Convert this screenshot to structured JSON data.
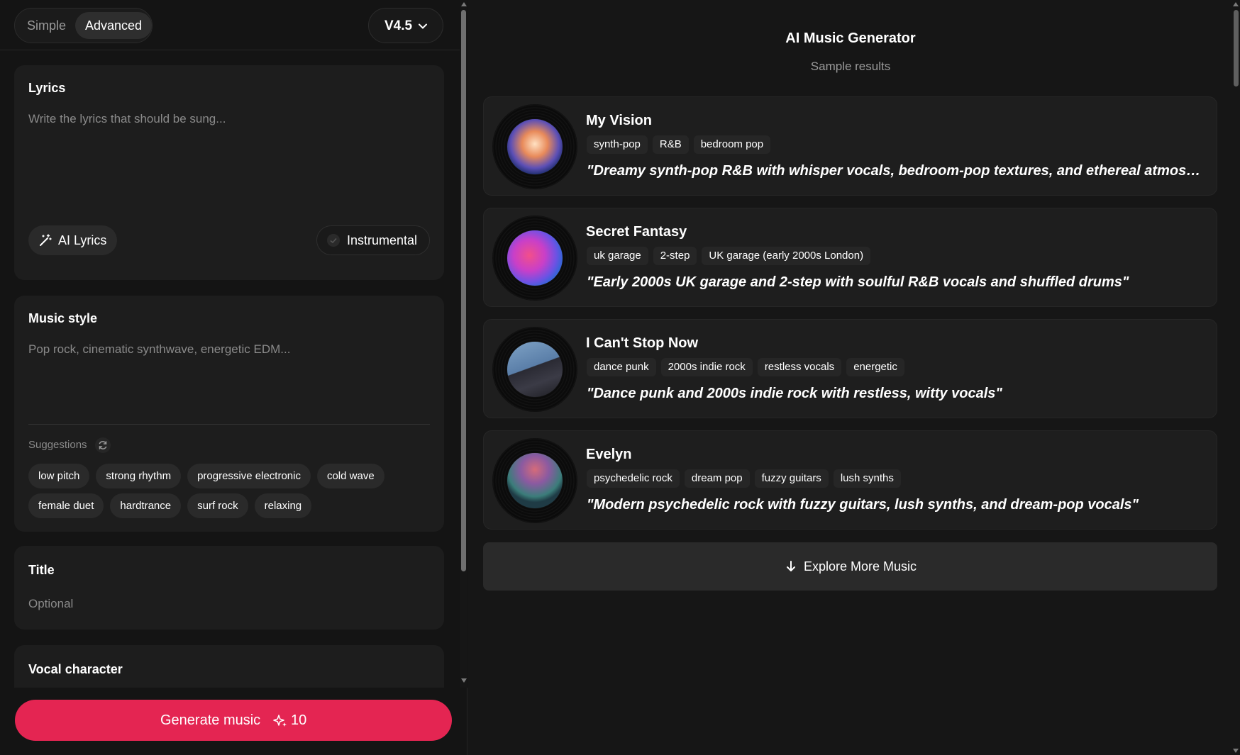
{
  "mode_toggle": {
    "simple": "Simple",
    "advanced": "Advanced",
    "selected": "Advanced"
  },
  "version": {
    "label": "V4.5"
  },
  "lyrics": {
    "label": "Lyrics",
    "placeholder": "Write the lyrics that should be sung...",
    "ai_lyrics_button": "AI Lyrics",
    "instrumental_button": "Instrumental"
  },
  "music_style": {
    "label": "Music style",
    "placeholder": "Pop rock, cinematic synthwave, energetic EDM...",
    "suggestions_label": "Suggestions",
    "chips_row1": [
      "low pitch",
      "strong rhythm",
      "progressive electronic",
      "cold wave"
    ],
    "chips_row2": [
      "female duet",
      "hardtrance",
      "surf rock",
      "relaxing"
    ]
  },
  "title_field": {
    "label": "Title",
    "placeholder": "Optional"
  },
  "vocal": {
    "label": "Vocal character"
  },
  "generate": {
    "label": "Generate music",
    "cost": "10"
  },
  "results": {
    "title": "AI Music Generator",
    "subtitle": "Sample results",
    "tracks": [
      {
        "title": "My Vision",
        "tags": [
          "synth-pop",
          "R&B",
          "bedroom pop"
        ],
        "description": "\"Dreamy synth-pop R&B with whisper vocals, bedroom-pop textures, and ethereal atmosphe..."
      },
      {
        "title": "Secret Fantasy",
        "tags": [
          "uk garage",
          "2-step",
          "UK garage (early 2000s London)"
        ],
        "description": "\"Early 2000s UK garage and 2-step with soulful R&B vocals and shuffled drums\""
      },
      {
        "title": "I Can't Stop Now",
        "tags": [
          "dance punk",
          "2000s indie rock",
          "restless vocals",
          "energetic"
        ],
        "description": "\"Dance punk and 2000s indie rock with restless, witty vocals\""
      },
      {
        "title": "Evelyn",
        "tags": [
          "psychedelic rock",
          "dream pop",
          "fuzzy guitars",
          "lush synths"
        ],
        "description": "\"Modern psychedelic rock with fuzzy guitars, lush synths, and dream-pop vocals\""
      }
    ],
    "explore_button": "Explore More Music"
  },
  "colors": {
    "accent": "#e42552",
    "background": "#151515",
    "card": "#1d1d1d",
    "chip": "#2a2a2a"
  },
  "icons": [
    "chevron-down-icon",
    "magic-wand-icon",
    "check-circle-icon",
    "refresh-icon",
    "sparkle-icon",
    "arrow-down-icon"
  ]
}
